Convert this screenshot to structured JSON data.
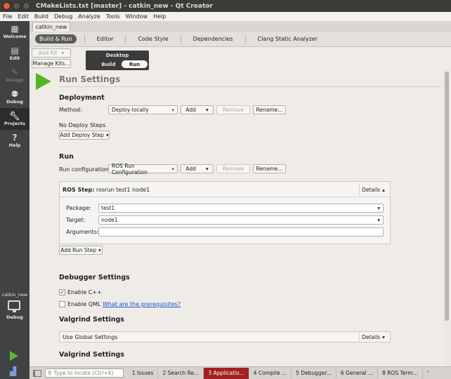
{
  "window": {
    "title": "CMakeLists.txt [master] - catkin_new - Qt Creator"
  },
  "menu": [
    "File",
    "Edit",
    "Build",
    "Debug",
    "Analyze",
    "Tools",
    "Window",
    "Help"
  ],
  "modes": {
    "welcome": "Welcome",
    "edit": "Edit",
    "design": "Design",
    "debug": "Debug",
    "projects": "Projects",
    "help": "Help"
  },
  "project_selector": {
    "name": "catkin_new",
    "config": "Debug"
  },
  "project_tab": "catkin_new",
  "subtabs": [
    "Build & Run",
    "Editor",
    "Code Style",
    "Dependencies",
    "Clang Static Analyzer"
  ],
  "kit": {
    "add_kit": "Add Kit",
    "manage_kits": "Manage Kits...",
    "name": "Desktop",
    "build": "Build",
    "run": "Run"
  },
  "page": {
    "title": "Run Settings"
  },
  "deployment": {
    "heading": "Deployment",
    "method_label": "Method:",
    "method_value": "Deploy locally",
    "add": "Add",
    "remove": "Remove",
    "rename": "Rename...",
    "no_steps": "No Deploy Steps",
    "add_step": "Add Deploy Step"
  },
  "run": {
    "heading": "Run",
    "config_label": "Run configuration:",
    "config_value": "ROS Run Configuration",
    "add": "Add",
    "remove": "Remove",
    "rename": "Rename..."
  },
  "ros_step": {
    "title_bold": "ROS Step:",
    "title_rest": " rosrun test1 node1",
    "details": "Details",
    "package_label": "Package:",
    "package_value": "test1",
    "target_label": "Target:",
    "target_value": "node1",
    "arguments_label": "Arguments:",
    "arguments_value": "",
    "add_run_step": "Add Run Step"
  },
  "debugger": {
    "heading": "Debugger Settings",
    "enable_cpp": "Enable C++",
    "enable_cpp_checked": true,
    "enable_qml": "Enable QML",
    "enable_qml_checked": false,
    "prereq_link": "What are the prerequisites?"
  },
  "valgrind": {
    "heading": "Valgrind Settings",
    "global": "Use Global Settings",
    "details": "Details",
    "heading2": "Valgrind Settings"
  },
  "statusbar": {
    "locator_placeholder": "Type to locate (Ctrl+K)",
    "panes": [
      "1 Issues",
      "2 Search Re...",
      "3 Applicatio...",
      "4 Compile ...",
      "5 Debugger...",
      "6 General ...",
      "8 ROS Term..."
    ]
  }
}
